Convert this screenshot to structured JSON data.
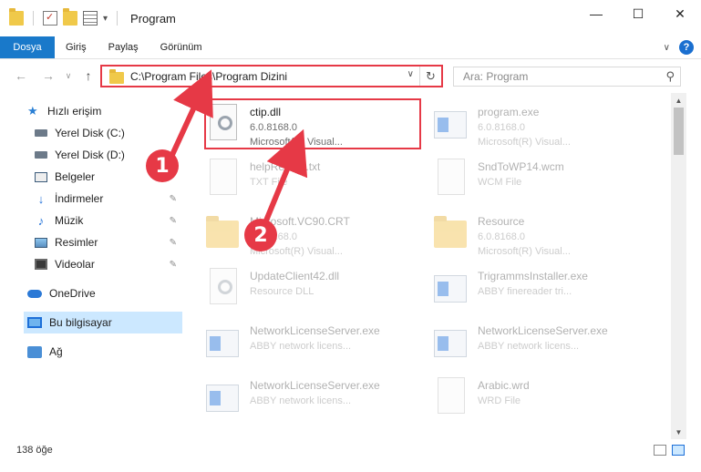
{
  "window": {
    "title": "Program"
  },
  "window_controls": {
    "minimize": "—",
    "maximize": "☐",
    "close": "✕"
  },
  "ribbon": {
    "tabs": [
      "Dosya",
      "Giriş",
      "Paylaş",
      "Görünüm"
    ]
  },
  "address": {
    "path": "C:\\Program Files\\Program Dizini"
  },
  "search": {
    "placeholder": "Ara: Program"
  },
  "sidebar": {
    "quick_access": "Hızlı erişim",
    "items": [
      "Yerel Disk (C:)",
      "Yerel Disk (D:)",
      "Belgeler",
      "İndirmeler",
      "Müzik",
      "Resimler",
      "Videolar"
    ],
    "onedrive": "OneDrive",
    "this_pc": "Bu bilgisayar",
    "network": "Ağ"
  },
  "files": [
    {
      "name": "ctip.dll",
      "line2": "6.0.8168.0",
      "line3": "Microsoft(R) Visual...",
      "icon": "dll-icon",
      "highlighted": true
    },
    {
      "name": "program.exe",
      "line2": "6.0.8168.0",
      "line3": "Microsoft(R) Visual...",
      "icon": "exe-icon"
    },
    {
      "name": "helpReader.txt",
      "line2": "TXT File",
      "icon": "txt-icon"
    },
    {
      "name": "SndToWP14.wcm",
      "line2": "WCM File",
      "icon": "file-icon"
    },
    {
      "name": "Microsoft.VC90.CRT",
      "line2": "6.0.8168.0",
      "line3": "Microsoft(R) Visual...",
      "icon": "folder-icon"
    },
    {
      "name": "Resource",
      "line2": "6.0.8168.0",
      "line3": "Microsoft(R) Visual...",
      "icon": "folder-icon"
    },
    {
      "name": "UpdateClient42.dll",
      "line2": "Resource DLL",
      "icon": "dll-icon"
    },
    {
      "name": "TrigrammsInstaller.exe",
      "line2": "ABBY finereader tri...",
      "icon": "exe-icon"
    },
    {
      "name": "NetworkLicenseServer.exe",
      "line2": "ABBY network licens...",
      "icon": "exe-icon"
    },
    {
      "name": "NetworkLicenseServer.exe",
      "line2": "ABBY network licens...",
      "icon": "exe-icon"
    },
    {
      "name": "NetworkLicenseServer.exe",
      "line2": "ABBY network licens...",
      "icon": "exe-icon"
    },
    {
      "name": "Arabic.wrd",
      "line2": "WRD File",
      "icon": "file-icon"
    }
  ],
  "status": {
    "count": "138 öğe"
  },
  "callouts": {
    "one": "1",
    "two": "2",
    "color": "#e63946"
  }
}
